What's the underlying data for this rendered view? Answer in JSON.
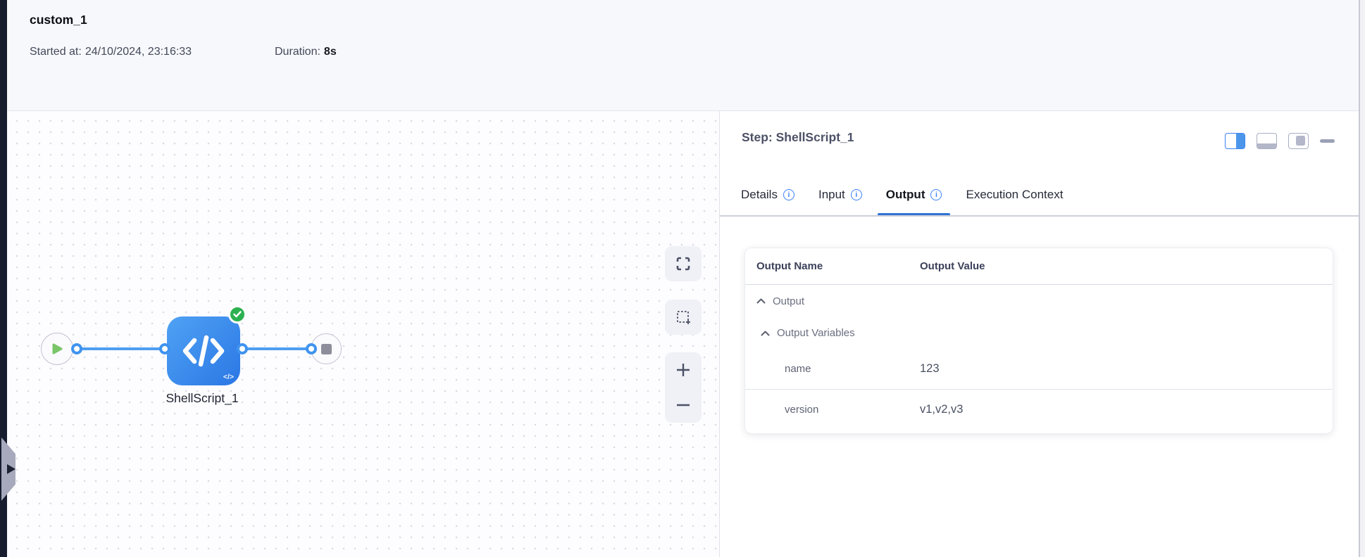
{
  "header": {
    "title": "custom_1",
    "started_label": "Started at:",
    "started_value": "24/10/2024, 23:16:33",
    "duration_label": "Duration:",
    "duration_value": "8s"
  },
  "canvas": {
    "node_label": "ShellScript_1",
    "node_status": "success",
    "icons": {
      "start": "play",
      "node_type": "code-brackets",
      "status_badge": "check-circle",
      "end": "stop",
      "controls": [
        "fit-view",
        "box-select",
        "zoom-in",
        "zoom-out"
      ]
    }
  },
  "panel": {
    "title": "Step: ShellScript_1",
    "layout_icons": [
      "split-right-active",
      "split-bottom",
      "floating-panel",
      "minimize"
    ],
    "tabs": [
      {
        "label": "Details",
        "info": true,
        "active": false
      },
      {
        "label": "Input",
        "info": true,
        "active": false
      },
      {
        "label": "Output",
        "info": true,
        "active": true
      },
      {
        "label": "Execution Context",
        "info": false,
        "active": false
      }
    ],
    "table": {
      "columns": [
        "Output Name",
        "Output Value"
      ],
      "groups": [
        {
          "label": "Output",
          "expanded": true
        },
        {
          "label": "Output Variables",
          "expanded": true
        }
      ],
      "rows": [
        {
          "name": "name",
          "value": "123"
        },
        {
          "name": "version",
          "value": "v1,v2,v3"
        }
      ]
    }
  },
  "colors": {
    "accent_blue": "#2f72d4",
    "node_blue_start": "#4fa2f4",
    "node_blue_end": "#2b77e5",
    "edge_blue": "#4e9ef1",
    "success_green": "#2cb151",
    "play_green": "#7ac568",
    "info_blue": "#3b82f6"
  }
}
